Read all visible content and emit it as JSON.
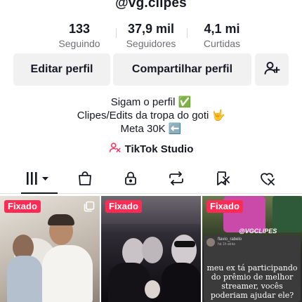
{
  "profile": {
    "username": "@vg.clipes"
  },
  "stats": [
    {
      "value": "133",
      "label": "Seguindo"
    },
    {
      "value": "37,9 mil",
      "label": "Seguidores"
    },
    {
      "value": "4,1 mi",
      "label": "Curtidas"
    }
  ],
  "actions": {
    "edit_label": "Editar perfil",
    "share_label": "Compartilhar perfil",
    "add_friend_icon": "person-plus-icon"
  },
  "bio": {
    "line1": "Sigam o perfil ✅",
    "line2": "Clipes/Edits da tropa do goti 🤟",
    "line3": "Meta 30K ⬅️"
  },
  "studio": {
    "label": "TikTok Studio",
    "icon": "tiktok-studio-icon"
  },
  "tabs": [
    {
      "icon": "videos-grid-icon",
      "active": true
    },
    {
      "icon": "shop-bag-icon",
      "active": false
    },
    {
      "icon": "lock-icon",
      "active": false
    },
    {
      "icon": "repost-icon",
      "active": false
    },
    {
      "icon": "favorites-icon",
      "active": false
    },
    {
      "icon": "liked-icon",
      "active": false
    }
  ],
  "videos": [
    {
      "badge": "Fixado",
      "multi": true
    },
    {
      "badge": "Fixado"
    },
    {
      "badge": "Fixado",
      "watermark": "@VGCLIPES",
      "story_user": "flavio_rabelo",
      "story_time": "há 1h atrás",
      "caption": "meu ex tá participando do prêmio de melhor streamer, vocês poderiam ajudar ele?"
    }
  ],
  "colors": {
    "accent": "#fe2c55",
    "text": "#161823",
    "muted": "#6e6e73",
    "button_bg": "#f1f1f2"
  }
}
